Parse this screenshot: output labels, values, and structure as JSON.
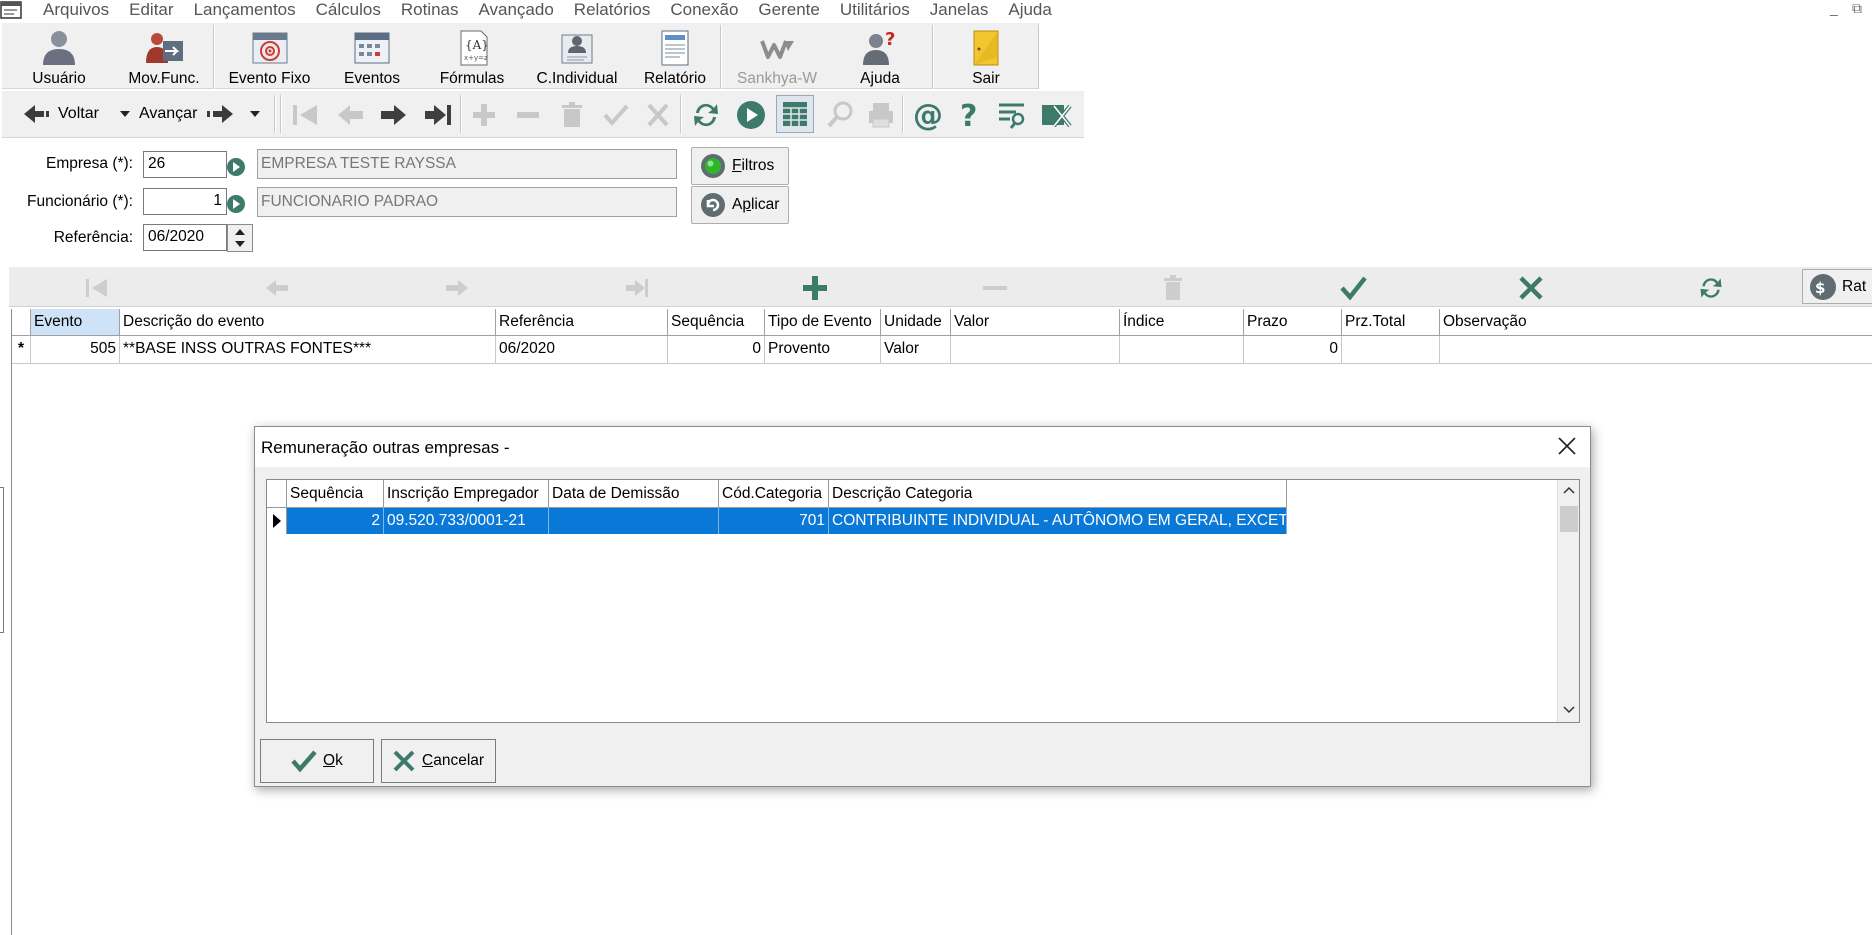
{
  "menu": {
    "items": [
      "Arquivos",
      "Editar",
      "Lançamentos",
      "Cálculos",
      "Rotinas",
      "Avançado",
      "Relatórios",
      "Conexão",
      "Gerente",
      "Utilitários",
      "Janelas",
      "Ajuda"
    ],
    "minimize": "_",
    "restore": "⧉"
  },
  "toolbar": {
    "buttons": [
      {
        "label": "Usuário",
        "icon": "users-icon"
      },
      {
        "label": "Mov.Func.",
        "icon": "employee-movement-icon"
      },
      {
        "label": "Evento Fixo",
        "icon": "fixed-event-icon"
      },
      {
        "label": "Eventos",
        "icon": "events-calendar-icon"
      },
      {
        "label": "Fórmulas",
        "icon": "formula-icon"
      },
      {
        "label": "C.Individual",
        "icon": "individual-card-icon"
      },
      {
        "label": "Relatório",
        "icon": "report-icon"
      },
      {
        "label": "Sankhya-W",
        "icon": "sankhya-logo-icon"
      },
      {
        "label": "Ajuda",
        "icon": "help-person-icon"
      },
      {
        "label": "Sair",
        "icon": "exit-icon"
      }
    ]
  },
  "nav": {
    "back_label": "Voltar",
    "forward_label": "Avançar"
  },
  "filters": {
    "empresa_label": "Empresa (*):",
    "empresa_code": "26",
    "empresa_name": "EMPRESA TESTE RAYSSA",
    "funcionario_label": "Funcionário (*):",
    "funcionario_code": "1",
    "funcionario_name": "FUNCIONARIO PADRAO",
    "referencia_label": "Referência:",
    "referencia_value": "06/2020",
    "filtros_hot": "F",
    "filtros_rest": "iltros",
    "aplicar_first": "A",
    "aplicar_hot": "p",
    "aplicar_rest": "licar"
  },
  "gridbar": {
    "rateio_label": "Rat"
  },
  "grid": {
    "columns": [
      "Evento",
      "Descrição do evento",
      "Referência",
      "Sequência",
      "Tipo de Evento",
      "Unidade",
      "Valor",
      "Índice",
      "Prazo",
      "Prz.Total",
      "Observação"
    ],
    "row_marker": "*",
    "row": {
      "evento": "505",
      "descricao": "**BASE INSS OUTRAS FONTES***",
      "referencia": "06/2020",
      "sequencia": "0",
      "tipo": "Provento",
      "unidade": "Valor",
      "valor": "",
      "indice": "",
      "prazo": "0",
      "prz_total": "",
      "observacao": ""
    }
  },
  "dialog": {
    "title": "Remuneração outras empresas -",
    "columns": [
      "Sequência",
      "Inscrição Empregador",
      "Data de Demissão",
      "Cód.Categoria",
      "Descrição Categoria"
    ],
    "row": {
      "sequencia": "2",
      "inscricao": "09.520.733/0001-21",
      "data_demissao": "",
      "cod_categoria": "701",
      "descricao": "CONTRIBUINTE INDIVIDUAL - AUTÔNOMO EM GERAL, EXCETO"
    },
    "ok_hot": "O",
    "ok_rest": "k",
    "cancel_hot": "C",
    "cancel_rest": "ancelar"
  },
  "colors": {
    "selection": "#0a78d7",
    "icon_green": "#3d7a6a",
    "toolbar_bg": "#f0f0f0"
  }
}
